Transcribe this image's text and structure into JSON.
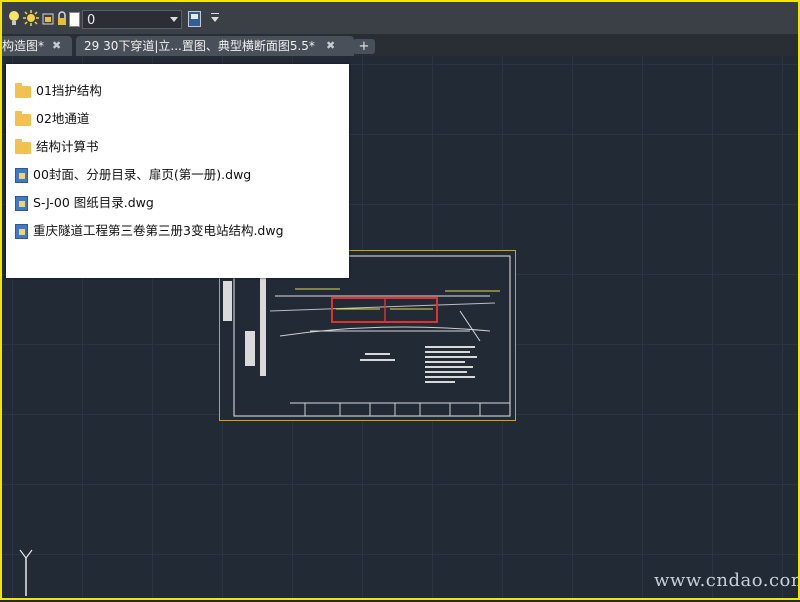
{
  "toolbar": {
    "layer_icons": [
      "lightbulb-icon",
      "sun-icon",
      "lock-icon"
    ],
    "layer_name": "0",
    "layer_color": "#ffffff",
    "icon_names": [
      "layer-properties-icon",
      "dropdown-icon"
    ]
  },
  "tabs": [
    {
      "label": "构造图*",
      "close": "✖"
    },
    {
      "label": "29   30下穿道|立...置图、典型横断面图5.5*",
      "close": "✖"
    }
  ],
  "add_tab": "+",
  "file_list": [
    {
      "type": "folder",
      "icon": "folder-icon",
      "name": "01挡护结构"
    },
    {
      "type": "folder",
      "icon": "folder-icon",
      "name": "02地通道"
    },
    {
      "type": "folder",
      "icon": "folder-icon",
      "name": "结构计算书"
    },
    {
      "type": "file",
      "icon": "dwg-file-icon",
      "name": "00封面、分册目录、扉页(第一册).dwg"
    },
    {
      "type": "file",
      "icon": "dwg-file-icon",
      "name": "S-J-00 图纸目录.dwg"
    },
    {
      "type": "file",
      "icon": "dwg-file-icon",
      "name": "重庆隧道工程第三卷第三册3变电站结构.dwg"
    }
  ],
  "ucs": {
    "axis_label": "Y"
  },
  "watermark": "www.cndao.com",
  "colors": {
    "frame": "#f2e600",
    "canvas": "#222a36",
    "thumbnail_border": "#d8a400",
    "highlight_box": "#e03030"
  }
}
